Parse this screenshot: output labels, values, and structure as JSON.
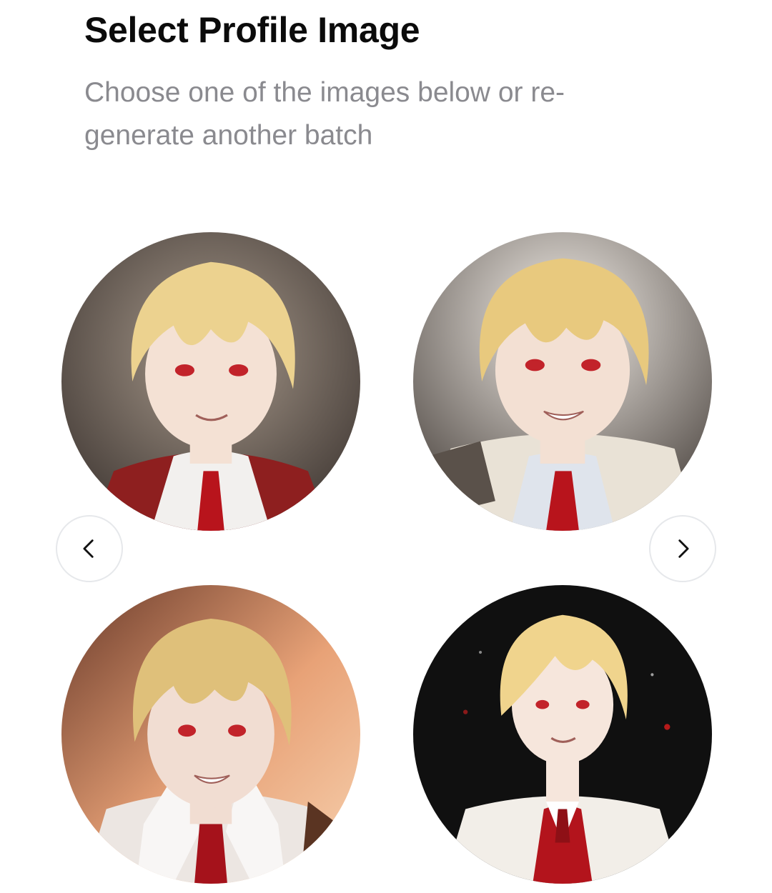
{
  "header": {
    "title": "Select Profile Image",
    "subtitle": "Choose one of the images below or re-generate another batch"
  },
  "carousel": {
    "prev_icon": "chevron-left-icon",
    "next_icon": "chevron-right-icon",
    "images": [
      {
        "id": "option-1",
        "palette": {
          "bg": "#6b5f55",
          "hair": "#ecd28f",
          "skin": "#f4e1d4",
          "jacket": "#8e1f1f",
          "tie": "#b8141c"
        }
      },
      {
        "id": "option-2",
        "palette": {
          "bg": "#b9b3ad",
          "hair": "#e8c97e",
          "skin": "#f3e0d3",
          "jacket": "#e9e2d6",
          "tie": "#b8141c"
        }
      },
      {
        "id": "option-3",
        "palette": {
          "bg": "#d78c62",
          "hair": "#dfc07a",
          "skin": "#f1ddd2",
          "jacket": "#ece6e2",
          "tie": "#a5121b"
        }
      },
      {
        "id": "option-4",
        "palette": {
          "bg": "#111111",
          "hair": "#f0d48d",
          "skin": "#f6e6dc",
          "jacket": "#f2eee8",
          "tie": "#b3141c"
        }
      }
    ]
  }
}
